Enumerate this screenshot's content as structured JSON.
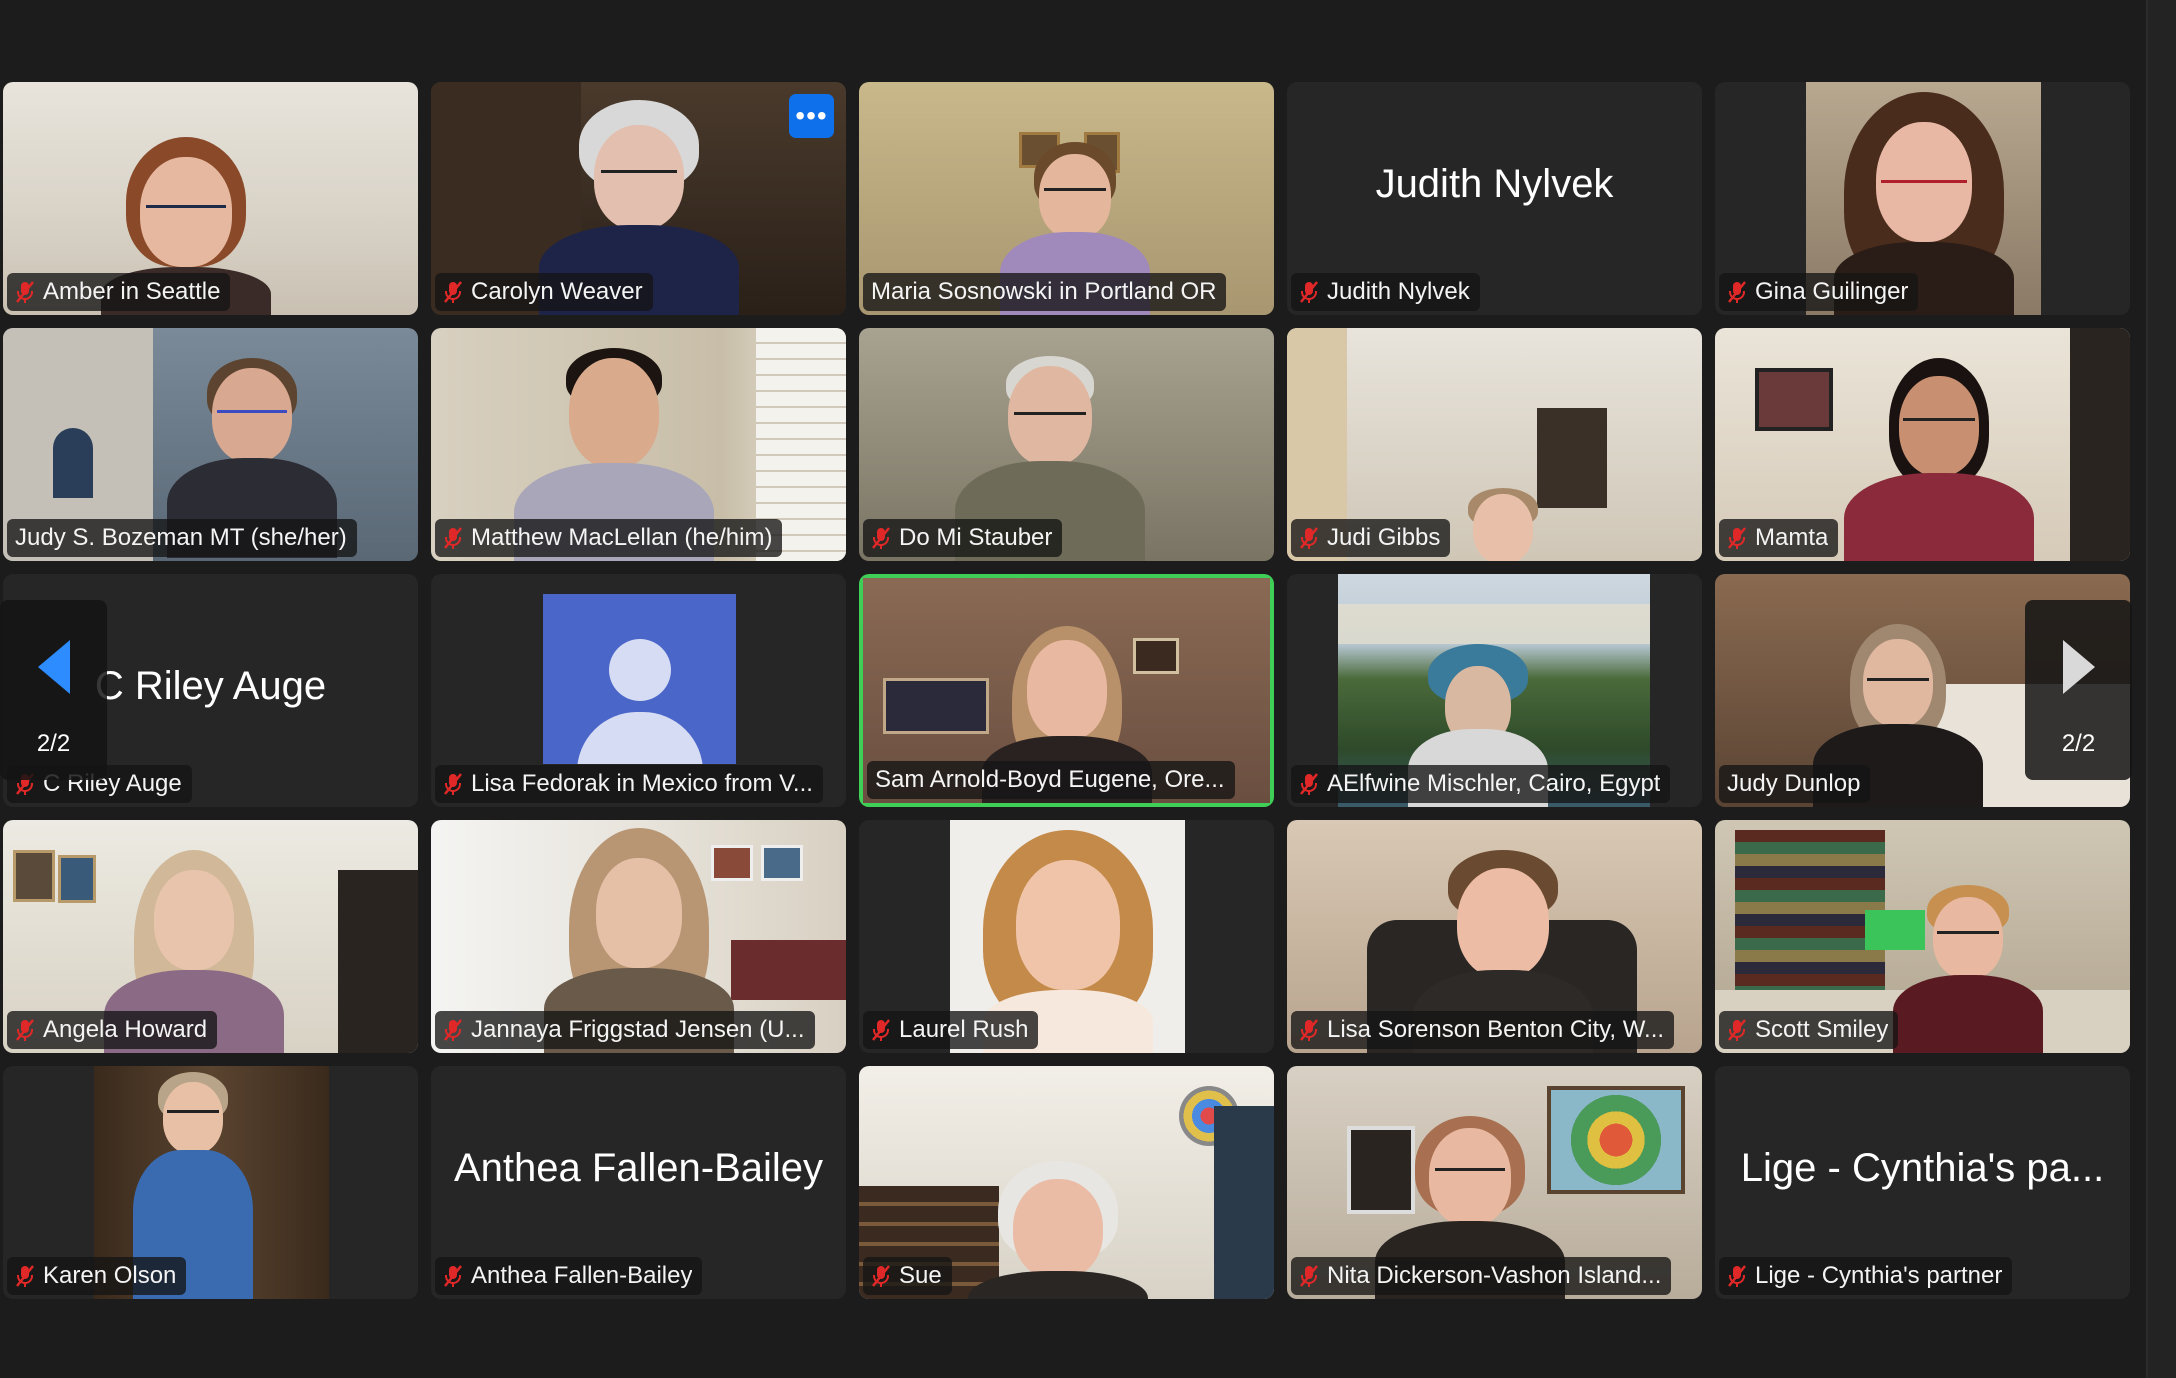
{
  "pagination": {
    "page_label": "2/2"
  },
  "more_button_label": "•••",
  "participants": [
    {
      "id": "amber",
      "label": "Amber in Seattle",
      "video": true,
      "muted": true
    },
    {
      "id": "carolyn",
      "label": "Carolyn Weaver",
      "video": true,
      "muted": true
    },
    {
      "id": "maria",
      "label": "Maria Sosnowski in Portland OR",
      "video": true,
      "muted": false
    },
    {
      "id": "judith",
      "label": "Judith Nylvek",
      "display_name": "Judith Nylvek",
      "video": false,
      "muted": true
    },
    {
      "id": "gina",
      "label": "Gina Guilinger",
      "video": true,
      "muted": true
    },
    {
      "id": "judy-b",
      "label": "Judy S. Bozeman MT (she/her)",
      "video": true,
      "muted": false
    },
    {
      "id": "matthew",
      "label": "Matthew MacLellan (he/him)",
      "video": true,
      "muted": true
    },
    {
      "id": "domi",
      "label": "Do Mi Stauber",
      "video": true,
      "muted": true
    },
    {
      "id": "judi",
      "label": "Judi Gibbs",
      "video": true,
      "muted": true
    },
    {
      "id": "mamta",
      "label": "Mamta",
      "video": true,
      "muted": true
    },
    {
      "id": "criley",
      "label": "C Riley Auge",
      "display_name": "C Riley Auge",
      "video": false,
      "muted": true
    },
    {
      "id": "lisaf",
      "label": "Lisa Fedorak in Mexico from V...",
      "video": false,
      "avatar": true,
      "muted": true
    },
    {
      "id": "sam",
      "label": "Sam Arnold-Boyd    Eugene, Ore...",
      "video": true,
      "muted": false,
      "active_speaker": true
    },
    {
      "id": "aelfwine",
      "label": "AElfwine Mischler, Cairo, Egypt",
      "video": true,
      "muted": true
    },
    {
      "id": "judyd",
      "label": "Judy Dunlop",
      "video": true,
      "muted": false
    },
    {
      "id": "angela",
      "label": "Angela Howard",
      "video": true,
      "muted": true
    },
    {
      "id": "jannaya",
      "label": "Jannaya Friggstad Jensen (U...",
      "video": true,
      "muted": true
    },
    {
      "id": "laurel",
      "label": "Laurel Rush",
      "video": true,
      "muted": true
    },
    {
      "id": "lisas",
      "label": "Lisa Sorenson Benton City, W...",
      "video": true,
      "muted": true
    },
    {
      "id": "scott",
      "label": "Scott Smiley",
      "video": true,
      "muted": true
    },
    {
      "id": "karen",
      "label": "Karen Olson",
      "video": true,
      "muted": true
    },
    {
      "id": "anthea",
      "label": "Anthea Fallen-Bailey",
      "display_name": "Anthea Fallen-Bailey",
      "video": false,
      "muted": true
    },
    {
      "id": "sue",
      "label": "Sue",
      "video": true,
      "muted": true
    },
    {
      "id": "nita",
      "label": "Nita Dickerson-Vashon Island...",
      "video": true,
      "muted": true
    },
    {
      "id": "lige",
      "label": "Lige - Cynthia's partner",
      "display_name": "Lige - Cynthia's pa...",
      "video": false,
      "muted": true
    }
  ],
  "colors": {
    "active_border": "#3fcf57",
    "more_button": "#0e71eb",
    "mute_icon": "#e02828",
    "prev_arrow": "#2d8cff"
  }
}
